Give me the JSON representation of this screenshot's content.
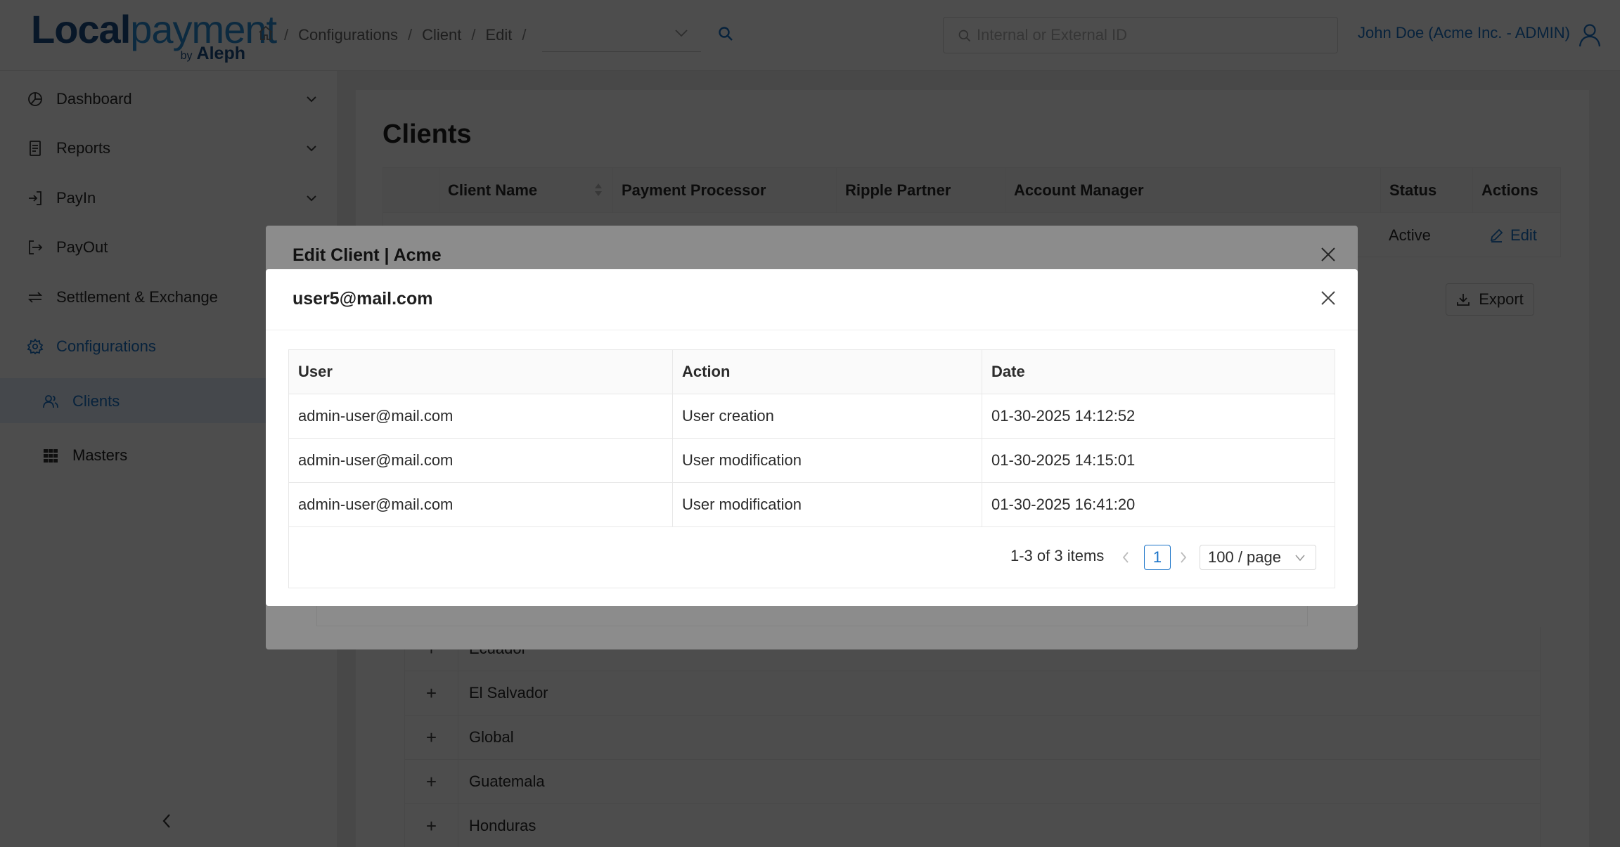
{
  "header": {
    "logo_main_a": "Local",
    "logo_main_b": "payment",
    "logo_by": "by",
    "logo_sub": "Aleph",
    "breadcrumbs": [
      "Configurations",
      "Client",
      "Edit"
    ],
    "search_placeholder": "Internal or External ID",
    "user_name": "John Doe (Acme Inc. - ADMIN)"
  },
  "sidebar": {
    "items": [
      {
        "label": "Dashboard",
        "icon": "pie-chart-icon"
      },
      {
        "label": "Reports",
        "icon": "report-icon"
      },
      {
        "label": "PayIn",
        "icon": "payin-icon"
      },
      {
        "label": "PayOut",
        "icon": "payout-icon"
      },
      {
        "label": "Settlement & Exchange",
        "icon": "exchange-icon"
      },
      {
        "label": "Configurations",
        "icon": "gear-icon"
      }
    ],
    "sub_items": [
      {
        "label": "Clients",
        "icon": "users-icon"
      },
      {
        "label": "Masters",
        "icon": "grid-icon"
      }
    ]
  },
  "main": {
    "title": "Clients",
    "columns": [
      "Client Name",
      "Payment Processor",
      "Ripple Partner",
      "Account Manager",
      "Status",
      "Actions"
    ],
    "row": {
      "status": "Active",
      "action": "Edit"
    },
    "export_label": "Export",
    "countries": [
      "Ecuador",
      "El Salvador",
      "Global",
      "Guatemala",
      "Honduras"
    ]
  },
  "edit_modal": {
    "title": "Edit Client | Acme"
  },
  "log_modal": {
    "title": "user5@mail.com",
    "columns": [
      "User",
      "Action",
      "Date"
    ],
    "rows": [
      {
        "user": "admin-user@mail.com",
        "action": "User creation",
        "date": "01-30-2025 14:12:52"
      },
      {
        "user": "admin-user@mail.com",
        "action": "User modification",
        "date": "01-30-2025 14:15:01"
      },
      {
        "user": "admin-user@mail.com",
        "action": "User modification",
        "date": "01-30-2025 16:41:20"
      }
    ],
    "pagination": {
      "total": "1-3 of 3 items",
      "current_page": "1",
      "page_size": "100 / page"
    }
  },
  "colors": {
    "accent": "#1a73c8",
    "brand_dark": "#1c4f86",
    "brand_light": "#2b8fd6"
  }
}
